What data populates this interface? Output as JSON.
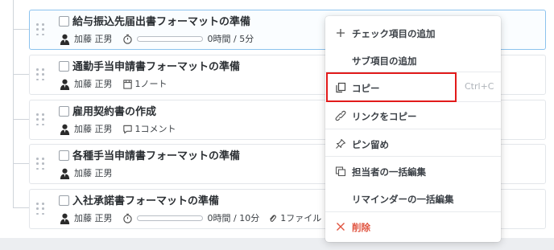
{
  "tasks": [
    {
      "title": "給与振込先届出書フォーマットの準備",
      "assignee": "加藤 正男",
      "progress": 0.0,
      "time": "0時間 / 5分",
      "selected": true
    },
    {
      "title": "通勤手当申請書フォーマットの準備",
      "assignee": "加藤 正男",
      "note_icon": "note-icon",
      "notes": "1ノート"
    },
    {
      "title": "雇用契約書の作成",
      "assignee": "加藤 正男",
      "comment_icon": "comment-icon",
      "comments": "1コメント"
    },
    {
      "title": "各種手当申請書フォーマットの準備",
      "assignee": "加藤 正男"
    },
    {
      "title": "入社承諾書フォーマットの準備",
      "assignee": "加藤 正男",
      "progress": 0.0,
      "time": "0時間 / 10分",
      "attachment_icon": "paperclip-icon",
      "files": "1ファイル"
    }
  ],
  "context_menu": {
    "items": [
      {
        "icon": "plus-icon",
        "label": "チェック項目の追加"
      },
      {
        "icon": "",
        "label": "サブ項目の追加"
      },
      {
        "icon": "copy-icon",
        "label": "コピー",
        "shortcut": "Ctrl+C",
        "highlighted": true
      },
      {
        "icon": "link-icon",
        "label": "リンクをコピー"
      },
      {
        "icon": "pin-icon",
        "label": "ピン留め"
      },
      {
        "icon": "assignee-edit-icon",
        "label": "担当者の一括編集"
      },
      {
        "icon": "",
        "label": "リマインダーの一括編集"
      },
      {
        "icon": "close-icon",
        "label": "削除",
        "danger": true
      }
    ]
  },
  "colors": {
    "highlight": "#e21a1a",
    "danger": "#e0533f",
    "selected_border": "#8cc3ee"
  }
}
